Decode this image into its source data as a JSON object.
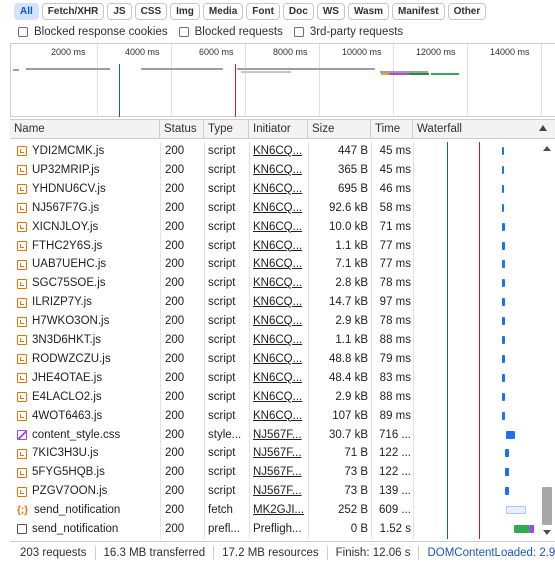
{
  "filters": [
    "All",
    "Fetch/XHR",
    "JS",
    "CSS",
    "Img",
    "Media",
    "Font",
    "Doc",
    "WS",
    "Wasm",
    "Manifest",
    "Other"
  ],
  "active_filter": "All",
  "checkboxes": [
    "Blocked response cookies",
    "Blocked requests",
    "3rd-party requests"
  ],
  "overview_ticks": [
    "2000 ms",
    "4000 ms",
    "6000 ms",
    "8000 ms",
    "10000 ms",
    "12000 ms",
    "14000 ms"
  ],
  "columns": {
    "name": "Name",
    "status": "Status",
    "type": "Type",
    "initiator": "Initiator",
    "size": "Size",
    "time": "Time",
    "waterfall": "Waterfall"
  },
  "rows": [
    {
      "name": "YDI2MCMK.js",
      "icon": "js",
      "status": "200",
      "type": "script",
      "initiator": "KN6CQ...",
      "size": "447 B",
      "time": "45 ms"
    },
    {
      "name": "UP32MRIP.js",
      "icon": "js",
      "status": "200",
      "type": "script",
      "initiator": "KN6CQ...",
      "size": "365 B",
      "time": "45 ms"
    },
    {
      "name": "YHDNU6CV.js",
      "icon": "js",
      "status": "200",
      "type": "script",
      "initiator": "KN6CQ...",
      "size": "695 B",
      "time": "46 ms"
    },
    {
      "name": "NJ567F7G.js",
      "icon": "js",
      "status": "200",
      "type": "script",
      "initiator": "KN6CQ...",
      "size": "92.6 kB",
      "time": "58 ms"
    },
    {
      "name": "XICNJLOY.js",
      "icon": "js",
      "status": "200",
      "type": "script",
      "initiator": "KN6CQ...",
      "size": "10.0 kB",
      "time": "71 ms"
    },
    {
      "name": "FTHC2Y6S.js",
      "icon": "js",
      "status": "200",
      "type": "script",
      "initiator": "KN6CQ...",
      "size": "1.1 kB",
      "time": "77 ms"
    },
    {
      "name": "UAB7UEHC.js",
      "icon": "js",
      "status": "200",
      "type": "script",
      "initiator": "KN6CQ...",
      "size": "7.1 kB",
      "time": "77 ms"
    },
    {
      "name": "SGC75SOE.js",
      "icon": "js",
      "status": "200",
      "type": "script",
      "initiator": "KN6CQ...",
      "size": "2.8 kB",
      "time": "78 ms"
    },
    {
      "name": "ILRIZP7Y.js",
      "icon": "js",
      "status": "200",
      "type": "script",
      "initiator": "KN6CQ...",
      "size": "14.7 kB",
      "time": "97 ms"
    },
    {
      "name": "H7WKO3ON.js",
      "icon": "js",
      "status": "200",
      "type": "script",
      "initiator": "KN6CQ...",
      "size": "2.9 kB",
      "time": "78 ms"
    },
    {
      "name": "3N3D6HKT.js",
      "icon": "js",
      "status": "200",
      "type": "script",
      "initiator": "KN6CQ...",
      "size": "1.1 kB",
      "time": "88 ms"
    },
    {
      "name": "RODWZCZU.js",
      "icon": "js",
      "status": "200",
      "type": "script",
      "initiator": "KN6CQ...",
      "size": "48.8 kB",
      "time": "79 ms"
    },
    {
      "name": "JHE4OTAE.js",
      "icon": "js",
      "status": "200",
      "type": "script",
      "initiator": "KN6CQ...",
      "size": "48.4 kB",
      "time": "83 ms"
    },
    {
      "name": "E4LACLO2.js",
      "icon": "js",
      "status": "200",
      "type": "script",
      "initiator": "KN6CQ...",
      "size": "2.9 kB",
      "time": "88 ms"
    },
    {
      "name": "4WOT6463.js",
      "icon": "js",
      "status": "200",
      "type": "script",
      "initiator": "KN6CQ...",
      "size": "107 kB",
      "time": "89 ms"
    },
    {
      "name": "content_style.css",
      "icon": "css",
      "status": "200",
      "type": "style...",
      "initiator": "NJ567F...",
      "size": "30.7 kB",
      "time": "716 ..."
    },
    {
      "name": "7KIC3H3U.js",
      "icon": "js",
      "status": "200",
      "type": "script",
      "initiator": "NJ567F...",
      "size": "71 B",
      "time": "122 ..."
    },
    {
      "name": "5FYG5HQB.js",
      "icon": "js",
      "status": "200",
      "type": "script",
      "initiator": "NJ567F...",
      "size": "73 B",
      "time": "122 ..."
    },
    {
      "name": "PZGV7OON.js",
      "icon": "js",
      "status": "200",
      "type": "script",
      "initiator": "NJ567F...",
      "size": "73 B",
      "time": "139 ..."
    },
    {
      "name": "send_notification",
      "icon": "fetch",
      "status": "200",
      "type": "fetch",
      "initiator": "MK2GJI...",
      "size": "252 B",
      "time": "609 ..."
    },
    {
      "name": "send_notification",
      "icon": "doc",
      "status": "200",
      "type": "prefl...",
      "initiator": "Prefligh...",
      "size": "0 B",
      "time": "1.52 s"
    }
  ],
  "status_bar": {
    "requests": "203 requests",
    "transferred": "16.3 MB transferred",
    "resources": "17.2 MB resources",
    "finish": "Finish: 12.06 s",
    "dom_content_loaded": "DOMContentLoaded: 2.92 s"
  },
  "colors": {
    "accent": "#0b57d0",
    "dom_content_loaded_line": "#1a55c7",
    "load_line": "#c5221f",
    "waterfall_bar": "#1a73e8"
  }
}
